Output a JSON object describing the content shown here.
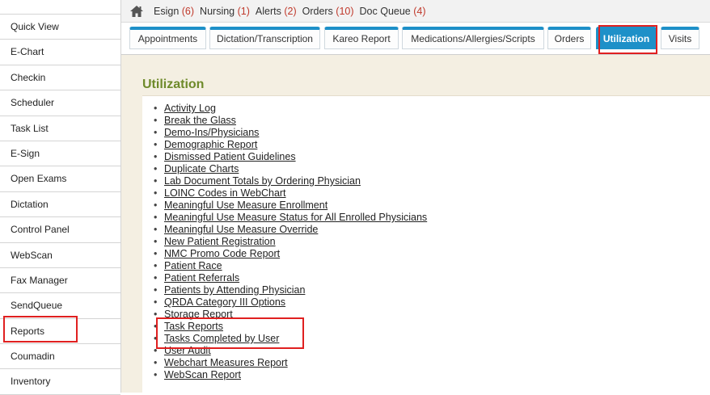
{
  "sidebar": {
    "items": [
      "Quick View",
      "E-Chart",
      "Checkin",
      "Scheduler",
      "Task List",
      "E-Sign",
      "Open Exams",
      "Dictation",
      "Control Panel",
      "WebScan",
      "Fax Manager",
      "SendQueue",
      "Reports",
      "Coumadin",
      "Inventory"
    ]
  },
  "topbar": {
    "home_icon": "home-icon",
    "items": [
      {
        "label": "Esign",
        "count": "(6)"
      },
      {
        "label": "Nursing",
        "count": "(1)"
      },
      {
        "label": "Alerts",
        "count": "(2)"
      },
      {
        "label": "Orders",
        "count": "(10)"
      },
      {
        "label": "Doc Queue",
        "count": "(4)"
      }
    ]
  },
  "tabs": [
    "Appointments",
    "Dictation/Transcription",
    "Kareo Report",
    "Medications/Allergies/Scripts",
    "Orders",
    "Utilization",
    "Visits"
  ],
  "active_tab": "Utilization",
  "main": {
    "title": "Utilization",
    "links": [
      "Activity Log",
      "Break the Glass",
      "Demo-Ins/Physicians",
      "Demographic Report",
      "Dismissed Patient Guidelines",
      "Duplicate Charts",
      "Lab Document Totals by Ordering Physician",
      "LOINC Codes in WebChart",
      "Meaningful Use Measure Enrollment",
      "Meaningful Use Measure Status for All Enrolled Physicians",
      "Meaningful Use Measure Override",
      "New Patient Registration",
      "NMC Promo Code Report",
      "Patient Race",
      "Patient Referrals",
      "Patients by Attending Physician",
      "QRDA Category III Options",
      "Storage Report",
      "Task Reports",
      "Tasks Completed by User",
      "User Audit",
      "Webchart Measures Report",
      "WebScan Report"
    ]
  },
  "colors": {
    "accent_tab": "#1e90c8",
    "title_green": "#6e8a2a",
    "count_red": "#c0392b",
    "highlight_red": "#e02020",
    "content_bg": "#f4efe2"
  }
}
